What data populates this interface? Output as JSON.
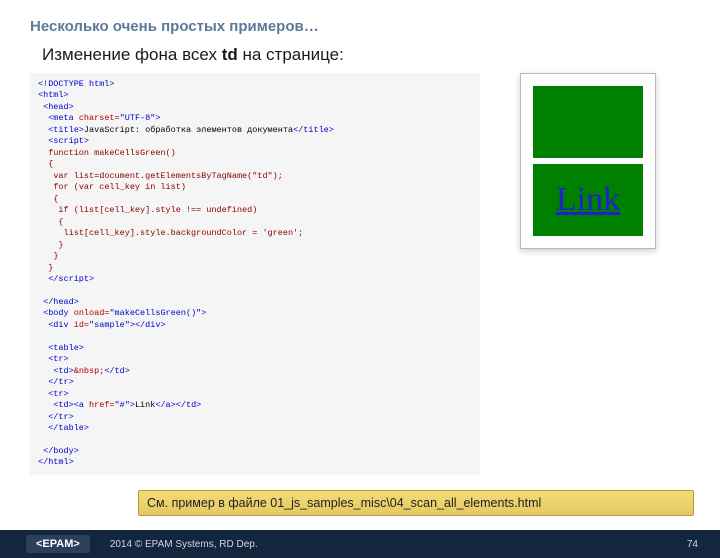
{
  "header": {
    "title": "Несколько очень простых примеров…"
  },
  "subtitle_pre": "Изменение фона всех ",
  "subtitle_bold": "td",
  "subtitle_post": " на странице:",
  "code": {},
  "preview": {
    "link_text": "Link"
  },
  "note": "См. пример в файле 01_js_samples_misc\\04_scan_all_elements.html",
  "footer": {
    "logo": "<EPAM>",
    "text": "2014 © EPAM Systems, RD Dep.",
    "page": "74"
  }
}
